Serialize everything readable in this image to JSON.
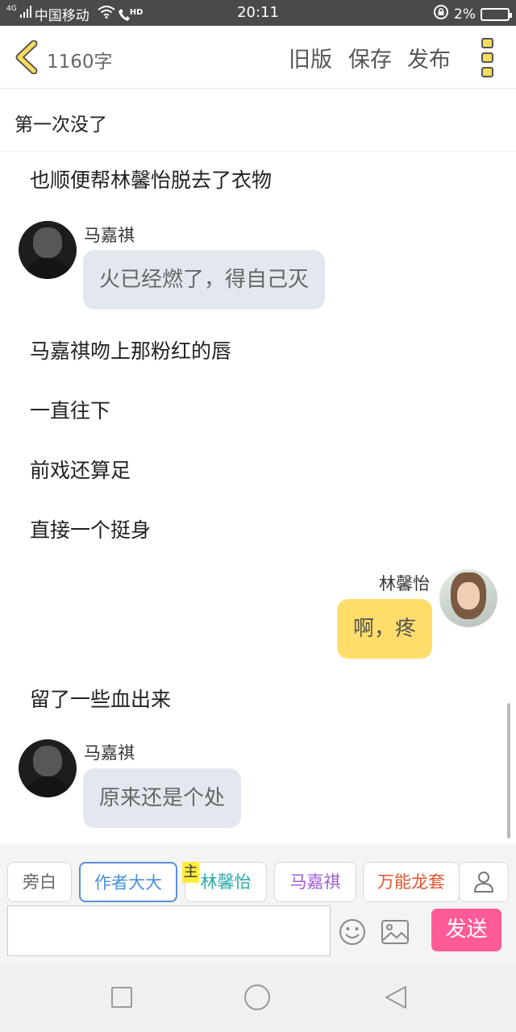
{
  "status_bar": {
    "network": "4G",
    "carrier": "中国移动",
    "hd": "HD",
    "time": "20:11",
    "battery": "2%"
  },
  "toolbar": {
    "word_count": "1160字",
    "old_version_label": "旧版",
    "save_label": "保存",
    "publish_label": "发布"
  },
  "chapter": {
    "title": "第一次没了"
  },
  "story": {
    "narration_1": "也顺便帮林馨怡脱去了衣物",
    "msg_1": {
      "speaker": "马嘉祺",
      "text": "火已经燃了，得自己灭"
    },
    "narration_2": "马嘉祺吻上那粉红的唇",
    "narration_3": "一直往下",
    "narration_4": "前戏还算足",
    "narration_5": "直接一个挺身",
    "msg_2": {
      "speaker": "林馨怡",
      "text": "啊，疼"
    },
    "narration_6": "留了一些血出来",
    "msg_3": {
      "speaker": "马嘉祺",
      "text": "原来还是个处"
    }
  },
  "roles": {
    "narrator": "旁白",
    "author": "作者大大",
    "main_badge": "主",
    "lin": "林馨怡",
    "ma": "马嘉祺",
    "wanneng": "万能龙套"
  },
  "composer": {
    "input_value": "",
    "send_label": "发送"
  },
  "colors": {
    "accent_yellow": "#ffdd6b",
    "send_pink": "#ff5b98",
    "bubble_grey": "#e3e8f0",
    "back_icon": "#f1c40f"
  }
}
